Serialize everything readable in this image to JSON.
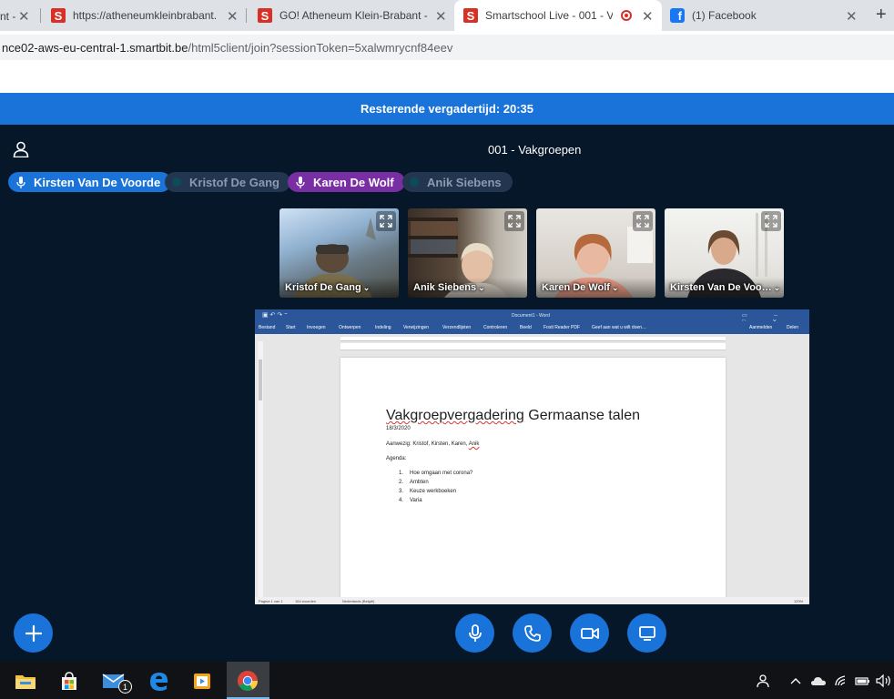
{
  "browser": {
    "tabs": [
      {
        "label": "nt -",
        "active": false
      },
      {
        "label": "https://atheneumkleinbrabant.",
        "active": false
      },
      {
        "label": "GO! Atheneum Klein-Brabant -",
        "active": false
      },
      {
        "label": "Smartschool Live - 001 - V",
        "active": true
      },
      {
        "label": "(1) Facebook",
        "active": false
      }
    ],
    "address": {
      "host": "nce02-aws-eu-central-1.smartbit.be",
      "path": "/html5client/join?sessionToken=5xalwmrycnf84eev"
    }
  },
  "meeting": {
    "remaining_time": "Resterende vergadertijd: 20:35",
    "title": "001 - Vakgroepen",
    "talkers": [
      {
        "name": "Kirsten Van De Voorde",
        "state": "speaking"
      },
      {
        "name": "Kristof De Gang",
        "state": "muted"
      },
      {
        "name": "Karen De Wolf",
        "state": "speaking-alt"
      },
      {
        "name": "Anik Siebens",
        "state": "muted"
      }
    ],
    "videos": [
      {
        "name": "Kristof De Gang"
      },
      {
        "name": "Anik Siebens"
      },
      {
        "name": "Karen De Wolf"
      },
      {
        "name": "Kirsten Van De Voo…"
      }
    ]
  },
  "screenshare": {
    "window_title": "Document1 - Word",
    "ribbon_tabs": [
      "Bestand",
      "Start",
      "Invoegen",
      "Ontwerpen",
      "Indeling",
      "Verwijzingen",
      "Verzendlijsten",
      "Controleren",
      "Beeld",
      "Foxit Reader PDF",
      "Geef aan wat u wilt doen…"
    ],
    "ribbon_right": [
      "Aanmelden",
      "Delen"
    ],
    "document": {
      "heading_part1": "Vakgroepvergadering",
      "heading_part2": " Germaanse talen",
      "date": "18/3/2020",
      "attendees_label": "Aanwezig: Kristof, Kirsten, Karen, ",
      "attendees_last": "Anik",
      "agenda_label": "Agenda:",
      "agenda_items": [
        {
          "num": "1.",
          "text": "Hoe omgaan met corona?"
        },
        {
          "num": "2.",
          "text": "Ambten"
        },
        {
          "num": "3.",
          "text": "Keuze werkboeken"
        },
        {
          "num": "4.",
          "text": "Varia"
        }
      ]
    },
    "status_left": "Pagina 1 van 1",
    "status_words": "164 woorden",
    "status_lang": "Nederlands (België)",
    "zoom": "120%"
  },
  "colors": {
    "accent": "#1a73d9",
    "background": "#06172a",
    "word_blue": "#2b579a"
  },
  "icons": [
    "user-icon",
    "expand-icon",
    "microphone-icon",
    "phone-icon",
    "video-camera-icon",
    "screen-share-icon",
    "plus-icon",
    "file-explorer-icon",
    "store-icon",
    "mail-icon",
    "edge-icon",
    "media-player-icon",
    "chrome-icon"
  ],
  "taskbar": {
    "mail_badge": "1"
  }
}
